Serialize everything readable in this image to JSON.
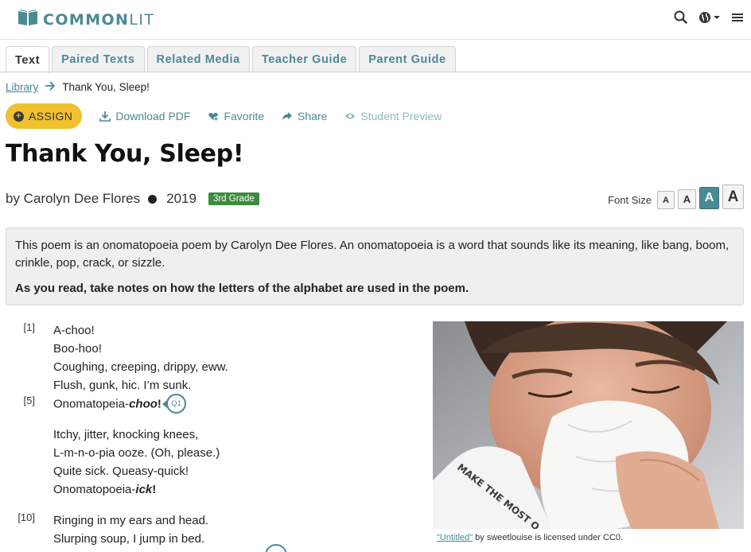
{
  "brand": {
    "name_bold": "COMMON",
    "name_light": "LIT"
  },
  "header": {
    "icons": [
      "search-icon",
      "globe-icon",
      "caret-down-icon",
      "menu-icon"
    ]
  },
  "tabs": [
    {
      "label": "Text",
      "active": true
    },
    {
      "label": "Paired Texts"
    },
    {
      "label": "Related Media"
    },
    {
      "label": "Teacher Guide"
    },
    {
      "label": "Parent Guide"
    }
  ],
  "breadcrumb": {
    "root": "Library",
    "current": "Thank You, Sleep!"
  },
  "actions": {
    "assign": "ASSIGN",
    "download": "Download PDF",
    "favorite": "Favorite",
    "share": "Share",
    "preview": "Student Preview"
  },
  "text": {
    "title": "Thank You, Sleep!",
    "author": "by Carolyn Dee Flores",
    "year": "2019",
    "grade": "3rd Grade"
  },
  "font_size": {
    "label": "Font Size",
    "letter": "A",
    "selected_index": 2
  },
  "intro": {
    "summary": "This poem is an onomatopoeia poem by Carolyn Dee Flores. An onomatopoeia is a word that sounds like its meaning, like bang, boom, crinkle, pop, crack, or sizzle.",
    "question": "As you read, take notes on how the letters of the alphabet are used in the poem."
  },
  "poem": {
    "line_1": "A-choo!",
    "line_2": "Boo-hoo!",
    "line_3": "Coughing, creeping, drippy, eww.",
    "line_4": "Flush, gunk, hic. I’m sunk.",
    "line_5_pre": "Onomatopeia-",
    "line_5_em": "choo",
    "line_5_post": "!",
    "line_6": "Itchy, jitter, knocking knees,",
    "line_7": "L-m-n-o-pia ooze. (Oh, please.)",
    "line_8": "Quite sick. Queasy-quick!",
    "line_9_pre": "Onomatopoeia-",
    "line_9_em": "ick",
    "line_9_post": "!",
    "line_10": "Ringing in my ears and head.",
    "line_11": "Slurping soup, I jump in bed.",
    "num_1": "[1]",
    "num_5": "[5]",
    "num_10": "[10]",
    "question_marker": "Q1"
  },
  "image": {
    "shirt_text": "MAKE THE MOST O",
    "caption_link": "\"Untitled\"",
    "caption_rest": " by sweetlouise is licensed under CC0."
  },
  "colors": {
    "brand_teal": "#4a8a93",
    "assign_yellow": "#f0c02f",
    "grade_green": "#3d8b40"
  }
}
